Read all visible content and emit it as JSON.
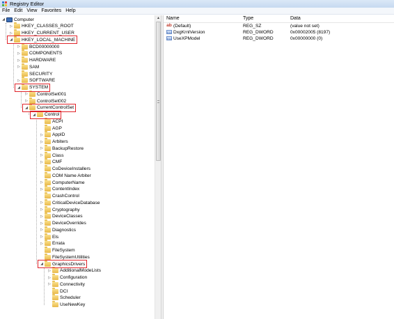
{
  "window": {
    "title": "Registry Editor"
  },
  "menu": [
    "File",
    "Edit",
    "View",
    "Favorites",
    "Help"
  ],
  "tree": [
    {
      "label": "Computer",
      "depth": 0,
      "expander": "collapse",
      "icon": "computer-icon"
    },
    {
      "label": "HKEY_CLASSES_ROOT",
      "depth": 1,
      "expander": "expand"
    },
    {
      "label": "HKEY_CURRENT_USER",
      "depth": 1,
      "expander": "expand"
    },
    {
      "label": "HKEY_LOCAL_MACHINE",
      "depth": 1,
      "expander": "collapse",
      "highlighted": true
    },
    {
      "label": "BCD00000000",
      "depth": 2,
      "expander": "expand"
    },
    {
      "label": "COMPONENTS",
      "depth": 2,
      "expander": "expand"
    },
    {
      "label": "HARDWARE",
      "depth": 2,
      "expander": "expand"
    },
    {
      "label": "SAM",
      "depth": 2,
      "expander": "expand"
    },
    {
      "label": "SECURITY",
      "depth": 2,
      "expander": "none"
    },
    {
      "label": "SOFTWARE",
      "depth": 2,
      "expander": "expand"
    },
    {
      "label": "SYSTEM",
      "depth": 2,
      "expander": "collapse",
      "highlighted": true
    },
    {
      "label": "ControlSet001",
      "depth": 3,
      "expander": "expand"
    },
    {
      "label": "ControlSet002",
      "depth": 3,
      "expander": "expand"
    },
    {
      "label": "CurrentControlSet",
      "depth": 3,
      "expander": "collapse",
      "highlighted": true
    },
    {
      "label": "Control",
      "depth": 4,
      "expander": "collapse",
      "highlighted": true
    },
    {
      "label": "ACPI",
      "depth": 5,
      "expander": "none"
    },
    {
      "label": "AGP",
      "depth": 5,
      "expander": "none"
    },
    {
      "label": "AppID",
      "depth": 5,
      "expander": "expand"
    },
    {
      "label": "Arbiters",
      "depth": 5,
      "expander": "expand"
    },
    {
      "label": "BackupRestore",
      "depth": 5,
      "expander": "expand"
    },
    {
      "label": "Class",
      "depth": 5,
      "expander": "expand"
    },
    {
      "label": "CMF",
      "depth": 5,
      "expander": "expand"
    },
    {
      "label": "CoDeviceInstallers",
      "depth": 5,
      "expander": "none"
    },
    {
      "label": "COM Name Arbiter",
      "depth": 5,
      "expander": "none"
    },
    {
      "label": "ComputerName",
      "depth": 5,
      "expander": "expand"
    },
    {
      "label": "ContentIndex",
      "depth": 5,
      "expander": "expand"
    },
    {
      "label": "CrashControl",
      "depth": 5,
      "expander": "none"
    },
    {
      "label": "CriticalDeviceDatabase",
      "depth": 5,
      "expander": "expand"
    },
    {
      "label": "Cryptography",
      "depth": 5,
      "expander": "expand"
    },
    {
      "label": "DeviceClasses",
      "depth": 5,
      "expander": "expand"
    },
    {
      "label": "DeviceOverrides",
      "depth": 5,
      "expander": "expand"
    },
    {
      "label": "Diagnostics",
      "depth": 5,
      "expander": "expand"
    },
    {
      "label": "Els",
      "depth": 5,
      "expander": "expand"
    },
    {
      "label": "Errata",
      "depth": 5,
      "expander": "expand"
    },
    {
      "label": "FileSystem",
      "depth": 5,
      "expander": "none"
    },
    {
      "label": "FileSystemUtilities",
      "depth": 5,
      "expander": "none"
    },
    {
      "label": "GraphicsDrivers",
      "depth": 5,
      "expander": "collapse",
      "highlighted": true,
      "selected": true
    },
    {
      "label": "AdditionalModeLists",
      "depth": 6,
      "expander": "expand"
    },
    {
      "label": "Configuration",
      "depth": 6,
      "expander": "expand"
    },
    {
      "label": "Connectivity",
      "depth": 6,
      "expander": "expand"
    },
    {
      "label": "DCI",
      "depth": 6,
      "expander": "none"
    },
    {
      "label": "Scheduler",
      "depth": 6,
      "expander": "none"
    },
    {
      "label": "UseNewKey",
      "depth": 6,
      "expander": "none"
    }
  ],
  "list": {
    "columns": [
      "Name",
      "Type",
      "Data"
    ],
    "rows": [
      {
        "icon": "string-value-icon",
        "name": "(Default)",
        "type": "REG_SZ",
        "data": "(value not set)"
      },
      {
        "icon": "dword-value-icon",
        "name": "DxgKrnlVersion",
        "type": "REG_DWORD",
        "data": "0x00002005 (8197)"
      },
      {
        "icon": "dword-value-icon",
        "name": "UseXPModel",
        "type": "REG_DWORD",
        "data": "0x00000000 (0)"
      }
    ]
  },
  "colors": {
    "highlight": "#e0242a",
    "folder": "#e9b94a",
    "computer": "#3a6db6"
  }
}
